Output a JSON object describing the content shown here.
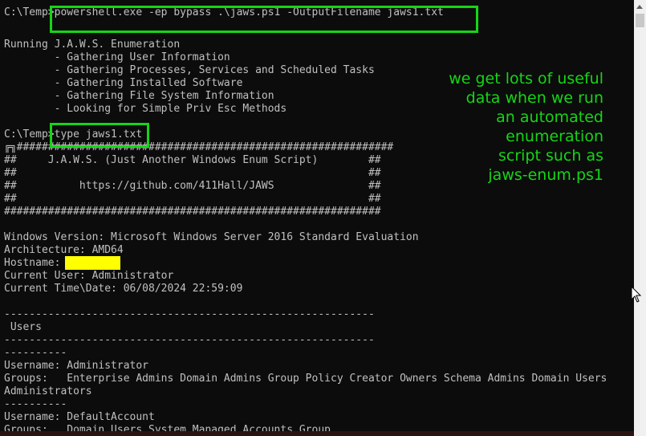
{
  "terminal": {
    "lines": [
      {
        "text": "C:\\Temp>powershell.exe -ep bypass .\\jaws.ps1 -OutputFilename jaws1.txt"
      },
      {
        "text": ""
      },
      {
        "text": "Running J.A.W.S. Enumeration"
      },
      {
        "text": "        - Gathering User Information"
      },
      {
        "text": "        - Gathering Processes, Services and Scheduled Tasks"
      },
      {
        "text": "        - Gathering Installed Software"
      },
      {
        "text": "        - Gathering File System Information"
      },
      {
        "text": "        - Looking for Simple Priv Esc Methods"
      },
      {
        "text": ""
      },
      {
        "text": "C:\\Temp>type jaws1.txt"
      },
      {
        "text": "╔╗############################################################"
      },
      {
        "text": "##     J.A.W.S. (Just Another Windows Enum Script)        ##"
      },
      {
        "text": "##                                                        ##"
      },
      {
        "text": "##          https://github.com/411Hall/JAWS               ##"
      },
      {
        "text": "##                                                        ##"
      },
      {
        "text": "############################################################"
      },
      {
        "text": ""
      },
      {
        "text": "Windows Version: Microsoft Windows Server 2016 Standard Evaluation"
      },
      {
        "text": "Architecture: AMD64"
      },
      {
        "text": "Hostname: "
      },
      {
        "text": "Current User: Administrator"
      },
      {
        "text": "Current Time\\Date: 06/08/2024 22:59:09"
      },
      {
        "text": ""
      },
      {
        "text": "-----------------------------------------------------------"
      },
      {
        "text": " Users"
      },
      {
        "text": "-----------------------------------------------------------"
      },
      {
        "text": "----------"
      },
      {
        "text": "Username: Administrator"
      },
      {
        "text": "Groups:   Enterprise Admins Domain Admins Group Policy Creator Owners Schema Admins Domain Users"
      },
      {
        "text": "Administrators"
      },
      {
        "text": "----------"
      },
      {
        "text": "Username: DefaultAccount"
      },
      {
        "text": "Groups:   Domain Users System Managed Accounts Group"
      }
    ]
  },
  "annotation": {
    "text": "we get lots of useful\ndata when we run\nan automated\nenumeration\nscript such as\njaws-enum.ps1"
  },
  "colors": {
    "background": "#0c0c0c",
    "text": "#c0c0c0",
    "highlight": "#16d516",
    "redaction": "#ffff00"
  },
  "icons": {
    "scroll_up": "triangle-up",
    "cursor": "arrow-pointer"
  }
}
